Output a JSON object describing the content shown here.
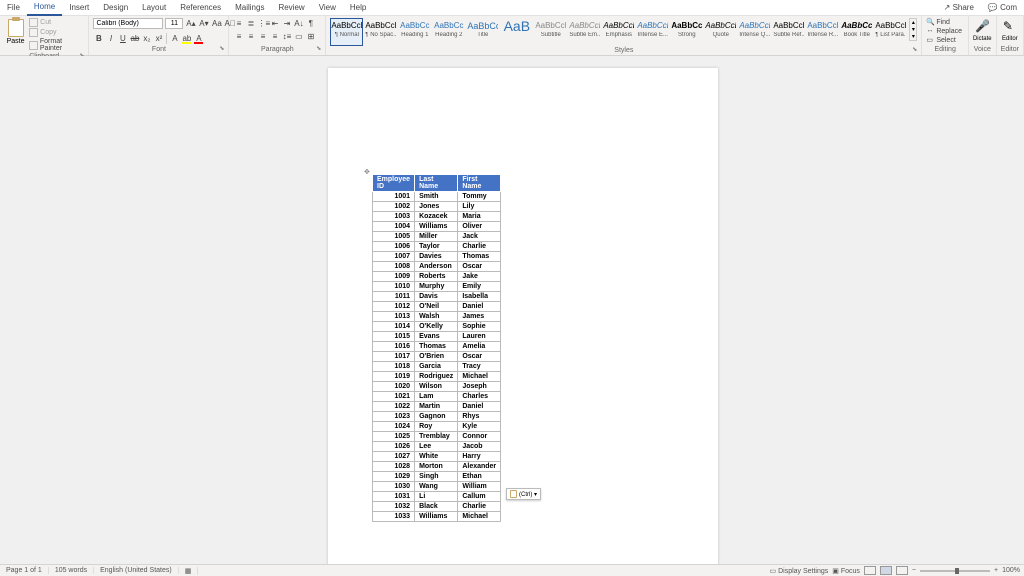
{
  "menu": {
    "tabs": [
      "File",
      "Home",
      "Insert",
      "Design",
      "Layout",
      "References",
      "Mailings",
      "Review",
      "View",
      "Help"
    ],
    "active": 1,
    "share": "Share",
    "comments": "Com"
  },
  "clipboard": {
    "paste": "Paste",
    "cut": "Cut",
    "copy": "Copy",
    "painter": "Format Painter",
    "label": "Clipboard"
  },
  "font": {
    "name": "Calibri (Body)",
    "size": "11",
    "label": "Font"
  },
  "para": {
    "label": "Paragraph"
  },
  "styles_label": "Styles",
  "styles": [
    {
      "prev": "AaBbCcDd",
      "name": "¶ Normal",
      "cls": "",
      "sel": true
    },
    {
      "prev": "AaBbCcDd",
      "name": "¶ No Spac..."
    },
    {
      "prev": "AaBbCc",
      "name": "Heading 1",
      "cls": "c1"
    },
    {
      "prev": "AaBbCc",
      "name": "Heading 2",
      "cls": "c1"
    },
    {
      "prev": "AaBbCcE",
      "name": "Title",
      "cls": "c2"
    },
    {
      "prev": "AaB",
      "name": "",
      "big": true
    },
    {
      "prev": "AaBbCcDd",
      "name": "Subtitle",
      "cls": "g"
    },
    {
      "prev": "AaBbCcDd",
      "name": "Subtle Em...",
      "cls": "gi"
    },
    {
      "prev": "AaBbCcDc",
      "name": "Emphasis",
      "cls": "i"
    },
    {
      "prev": "AaBbCcDc",
      "name": "Intense E...",
      "cls": "c1i"
    },
    {
      "prev": "AaBbCcDd",
      "name": "Strong",
      "cls": "b"
    },
    {
      "prev": "AaBbCcDc",
      "name": "Quote",
      "cls": "i"
    },
    {
      "prev": "AaBbCcDc",
      "name": "Intense Q...",
      "cls": "c1i"
    },
    {
      "prev": "AaBbCcDd",
      "name": "Subtle Ref..."
    },
    {
      "prev": "AaBbCcDd",
      "name": "Intense R...",
      "cls": "c1"
    },
    {
      "prev": "AaBbCcDd",
      "name": "Book Title",
      "cls": "bi"
    },
    {
      "prev": "AaBbCcDd",
      "name": "¶ List Para..."
    }
  ],
  "editing": {
    "find": "Find",
    "replace": "Replace",
    "select": "Select",
    "label": "Editing"
  },
  "voice": {
    "label": "Voice",
    "dictate": "Dictate"
  },
  "editor": {
    "label": "Editor",
    "btn": "Editor"
  },
  "paste_tag": "(Ctrl) ▾",
  "table": {
    "headers": [
      "Employee ID",
      "Last Name",
      "First Name"
    ],
    "rows": [
      [
        "1001",
        "Smith",
        "Tommy"
      ],
      [
        "1002",
        "Jones",
        "Lily"
      ],
      [
        "1003",
        "Kozacek",
        "Maria"
      ],
      [
        "1004",
        "Williams",
        "Oliver"
      ],
      [
        "1005",
        "Miller",
        "Jack"
      ],
      [
        "1006",
        "Taylor",
        "Charlie"
      ],
      [
        "1007",
        "Davies",
        "Thomas"
      ],
      [
        "1008",
        "Anderson",
        "Oscar"
      ],
      [
        "1009",
        "Roberts",
        "Jake"
      ],
      [
        "1010",
        "Murphy",
        "Emily"
      ],
      [
        "1011",
        "Davis",
        "Isabella"
      ],
      [
        "1012",
        "O'Neil",
        "Daniel"
      ],
      [
        "1013",
        "Walsh",
        "James"
      ],
      [
        "1014",
        "O'Kelly",
        "Sophie"
      ],
      [
        "1015",
        "Evans",
        "Lauren"
      ],
      [
        "1016",
        "Thomas",
        "Amelia"
      ],
      [
        "1017",
        "O'Brien",
        "Oscar"
      ],
      [
        "1018",
        "Garcia",
        "Tracy"
      ],
      [
        "1019",
        "Rodriguez",
        "Michael"
      ],
      [
        "1020",
        "Wilson",
        "Joseph"
      ],
      [
        "1021",
        "Lam",
        "Charles"
      ],
      [
        "1022",
        "Martin",
        "Daniel"
      ],
      [
        "1023",
        "Gagnon",
        "Rhys"
      ],
      [
        "1024",
        "Roy",
        "Kyle"
      ],
      [
        "1025",
        "Tremblay",
        "Connor"
      ],
      [
        "1026",
        "Lee",
        "Jacob"
      ],
      [
        "1027",
        "White",
        "Harry"
      ],
      [
        "1028",
        "Morton",
        "Alexander"
      ],
      [
        "1029",
        "Singh",
        "Ethan"
      ],
      [
        "1030",
        "Wang",
        "William"
      ],
      [
        "1031",
        "Li",
        "Callum"
      ],
      [
        "1032",
        "Black",
        "Charlie"
      ],
      [
        "1033",
        "Williams",
        "Michael"
      ]
    ]
  },
  "status": {
    "page": "Page 1 of 1",
    "words": "105 words",
    "lang": "English (United States)",
    "display": "Display Settings",
    "focus": "Focus",
    "zoom": "100%"
  }
}
